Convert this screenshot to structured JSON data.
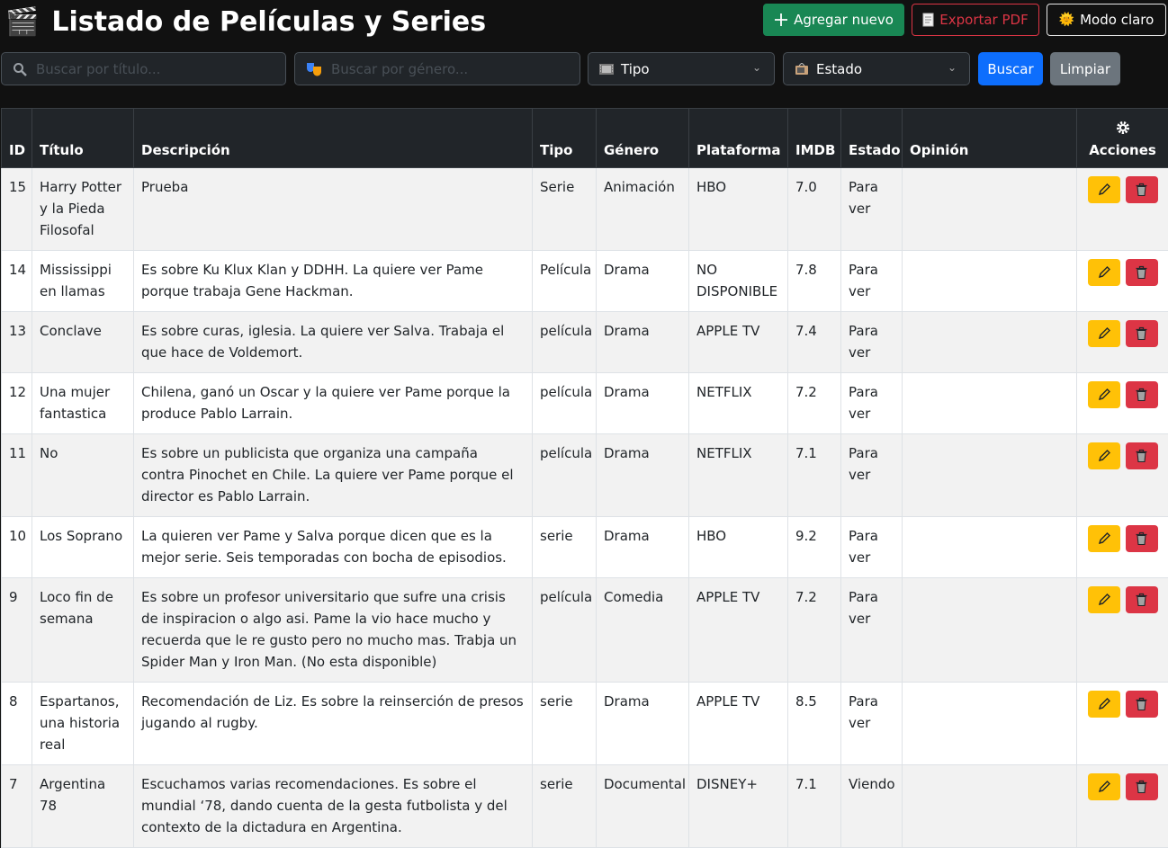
{
  "header": {
    "title_icon": "🎬",
    "title": "Listado de Películas y Series",
    "add_label": "Agregar nuevo",
    "pdf_label": "Exportar PDF",
    "mode_icon": "🌞",
    "mode_label": "Modo claro"
  },
  "filters": {
    "search_placeholder": "Buscar por título...",
    "genre_placeholder": "Buscar por género...",
    "tipo_label": "Tipo",
    "estado_label": "Estado",
    "buscar_label": "Buscar",
    "limpiar_label": "Limpiar"
  },
  "table": {
    "columns": [
      "ID",
      "Título",
      "Descripción",
      "Tipo",
      "Género",
      "Plataforma",
      "IMDB",
      "Estado",
      "Opinión",
      "Acciones"
    ],
    "rows": [
      {
        "id": "15",
        "titulo": "Harry Potter y la Pieda Filosofal",
        "descripcion": "Prueba",
        "tipo": "Serie",
        "genero": "Animación",
        "plataforma": "HBO",
        "imdb": "7.0",
        "estado": "Para ver",
        "opinion": ""
      },
      {
        "id": "14",
        "titulo": "Mississippi en llamas",
        "descripcion": "Es sobre Ku Klux Klan y DDHH. La quiere ver Pame porque trabaja Gene Hackman.",
        "tipo": "Película",
        "genero": "Drama",
        "plataforma": "NO DISPONIBLE",
        "imdb": "7.8",
        "estado": "Para ver",
        "opinion": ""
      },
      {
        "id": "13",
        "titulo": "Conclave",
        "descripcion": "Es sobre curas, iglesia. La quiere ver Salva. Trabaja el que hace de Voldemort.",
        "tipo": "película",
        "genero": "Drama",
        "plataforma": "APPLE TV",
        "imdb": "7.4",
        "estado": "Para ver",
        "opinion": ""
      },
      {
        "id": "12",
        "titulo": "Una mujer fantastica",
        "descripcion": "Chilena, ganó un Oscar y la quiere ver Pame porque la produce Pablo Larrain.",
        "tipo": "película",
        "genero": "Drama",
        "plataforma": "NETFLIX",
        "imdb": "7.2",
        "estado": "Para ver",
        "opinion": ""
      },
      {
        "id": "11",
        "titulo": "No",
        "descripcion": "Es sobre un publicista que organiza una campaña contra Pinochet en Chile. La quiere ver Pame porque el director es Pablo Larrain.",
        "tipo": "película",
        "genero": "Drama",
        "plataforma": "NETFLIX",
        "imdb": "7.1",
        "estado": "Para ver",
        "opinion": ""
      },
      {
        "id": "10",
        "titulo": "Los Soprano",
        "descripcion": "La quieren ver Pame y Salva porque dicen que es la mejor serie. Seis temporadas con bocha de episodios.",
        "tipo": "serie",
        "genero": "Drama",
        "plataforma": "HBO",
        "imdb": "9.2",
        "estado": "Para ver",
        "opinion": ""
      },
      {
        "id": "9",
        "titulo": "Loco fin de semana",
        "descripcion": "Es sobre un profesor universitario que sufre una crisis de inspiracion o algo asi. Pame la vio hace mucho y recuerda que le re gusto pero no mucho mas. Trabja un Spider Man y Iron Man. (No esta disponible)",
        "tipo": "película",
        "genero": "Comedia",
        "plataforma": "APPLE TV",
        "imdb": "7.2",
        "estado": "Para ver",
        "opinion": ""
      },
      {
        "id": "8",
        "titulo": "Espartanos, una historia real",
        "descripcion": "Recomendación de Liz. Es sobre la reinserción de presos jugando al rugby.",
        "tipo": "serie",
        "genero": "Drama",
        "plataforma": "APPLE TV",
        "imdb": "8.5",
        "estado": "Para ver",
        "opinion": ""
      },
      {
        "id": "7",
        "titulo": "Argentina 78",
        "descripcion": "Escuchamos varias recomendaciones. Es sobre el mundial ‘78, dando cuenta de la gesta futbolista y del contexto de la dictadura en Argentina.",
        "tipo": "serie",
        "genero": "Documental",
        "plataforma": "DISNEY+",
        "imdb": "7.1",
        "estado": "Viendo",
        "opinion": ""
      }
    ]
  },
  "colors": {
    "background": "#111111",
    "success": "#198754",
    "danger": "#dc3545",
    "primary": "#0d6efd",
    "secondary": "#6c757d",
    "warning": "#ffc107"
  },
  "icons": {
    "title": "clapperboard-icon",
    "add": "plus-icon",
    "pdf": "document-icon",
    "mode": "sun-icon",
    "search": "magnifier-icon",
    "genre": "theater-masks-icon",
    "tipo": "film-strip-icon",
    "estado": "tv-icon",
    "actions_header": "gear-icon",
    "edit": "pencil-icon",
    "delete": "trash-icon"
  }
}
